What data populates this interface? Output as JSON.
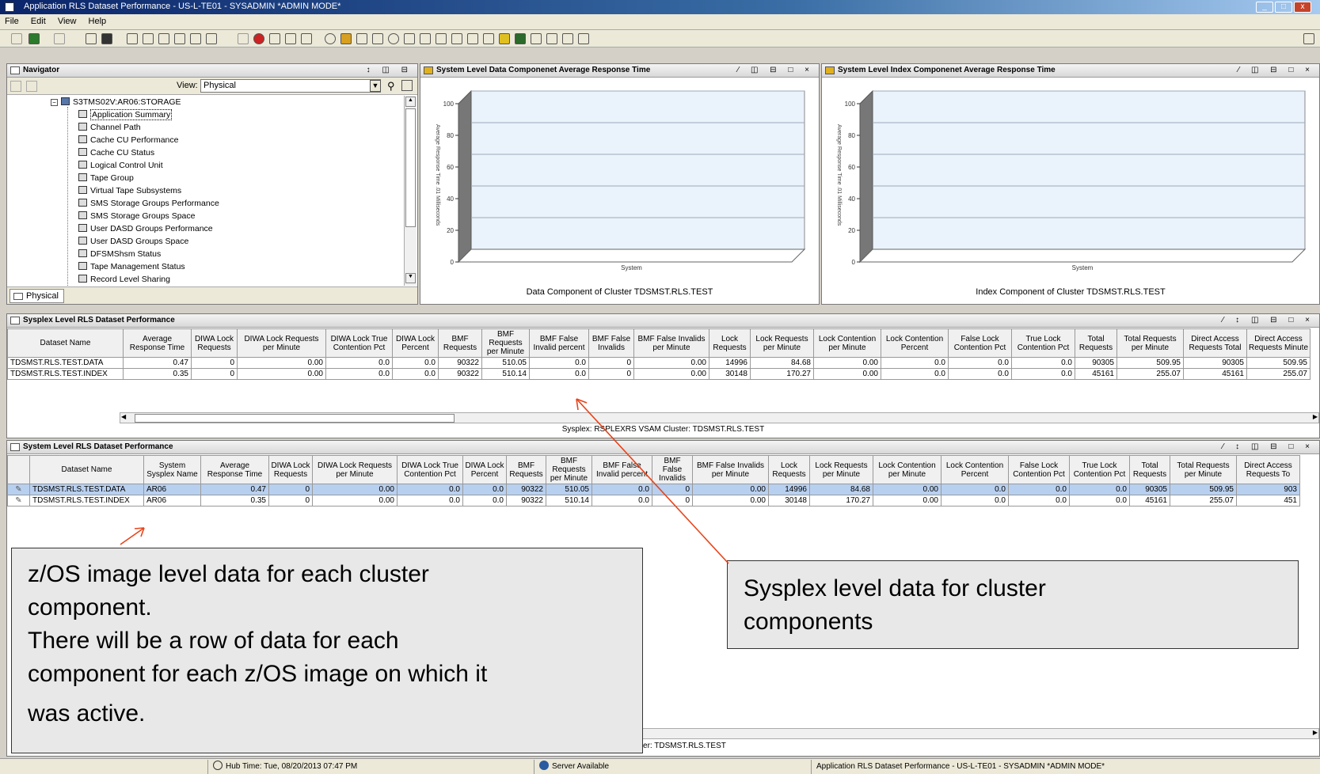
{
  "window": {
    "title": "Application RLS Dataset Performance - US-L-TE01 - SYSADMIN  *ADMIN MODE*"
  },
  "menu": {
    "file": "File",
    "edit": "Edit",
    "view": "View",
    "help": "Help"
  },
  "navigator": {
    "title": "Navigator",
    "view_label": "View:",
    "view_value": "Physical",
    "root": "S3TMS02V:AR06:STORAGE",
    "items": [
      "Application Summary",
      "Channel Path",
      "Cache CU Performance",
      "Cache CU Status",
      "Logical Control Unit",
      "Tape Group",
      "Virtual Tape Subsystems",
      "SMS Storage Groups Performance",
      "SMS Storage Groups Space",
      "User DASD Groups Performance",
      "User DASD Groups Space",
      "DFSMShsm Status",
      "Tape Management Status",
      "Record Level Sharing"
    ],
    "tab": "Physical"
  },
  "chart1": {
    "title": "System Level Data Componenet Average Response Time",
    "caption": "Data Component of Cluster TDSMST.RLS.TEST"
  },
  "chart2": {
    "title": "System Level Index Componenet Average Response Time",
    "caption": "Index Component of Cluster TDSMST.RLS.TEST"
  },
  "chart_data": [
    {
      "type": "bar",
      "title": "System Level Data Componenet Average Response Time",
      "xlabel": "System",
      "ylabel": "Average Response Time .01 Milliseconds",
      "categories": [],
      "values": [],
      "yticks": [
        "0",
        "20",
        "40",
        "60",
        "80",
        "100"
      ],
      "ylim": [
        0,
        100
      ],
      "grid": true
    },
    {
      "type": "bar",
      "title": "System Level Index Componenet Average Response Time",
      "xlabel": "System",
      "ylabel": "Average Response Time .01 Milliseconds",
      "categories": [],
      "values": [],
      "yticks": [
        "0",
        "20",
        "40",
        "60",
        "80",
        "100"
      ],
      "ylim": [
        0,
        100
      ],
      "grid": true
    }
  ],
  "sysplex_table": {
    "title": "Sysplex Level RLS Dataset Performance",
    "columns": [
      "Dataset Name",
      "Average Response Time",
      "DIWA Lock Requests",
      "DIWA Lock Requests per Minute",
      "DIWA Lock True Contention Pct",
      "DIWA Lock Percent",
      "BMF Requests",
      "BMF Requests per Minute",
      "BMF False Invalid percent",
      "BMF False Invalids",
      "BMF False Invalids per Minute",
      "Lock Requests",
      "Lock Requests per Minute",
      "Lock Contention per Minute",
      "Lock Contention Percent",
      "False Lock Contention Pct",
      "True Lock Contention Pct",
      "Total Requests",
      "Total Requests per Minute",
      "Direct Access Requests Total",
      "Direct Access Requests Minute"
    ],
    "rows": [
      [
        "TDSMST.RLS.TEST.DATA",
        "0.47",
        "0",
        "0.00",
        "0.0",
        "0.0",
        "90322",
        "510.05",
        "0.0",
        "0",
        "0.00",
        "14996",
        "84.68",
        "0.00",
        "0.0",
        "0.0",
        "0.0",
        "90305",
        "509.95",
        "90305",
        "509.95"
      ],
      [
        "TDSMST.RLS.TEST.INDEX",
        "0.35",
        "0",
        "0.00",
        "0.0",
        "0.0",
        "90322",
        "510.14",
        "0.0",
        "0",
        "0.00",
        "30148",
        "170.27",
        "0.00",
        "0.0",
        "0.0",
        "0.0",
        "45161",
        "255.07",
        "45161",
        "255.07"
      ]
    ],
    "footer": "Sysplex: RSPLEXRS  VSAM Cluster: TDSMST.RLS.TEST"
  },
  "system_table": {
    "title": "System Level RLS Dataset Performance",
    "columns": [
      "",
      "Dataset Name",
      "System Sysplex Name",
      "Average Response Time",
      "DIWA Lock Requests",
      "DIWA Lock Requests per Minute",
      "DIWA Lock True Contention Pct",
      "DIWA Lock Percent",
      "BMF Requests",
      "BMF Requests per Minute",
      "BMF False Invalid percent",
      "BMF False Invalids",
      "BMF False Invalids per Minute",
      "Lock Requests",
      "Lock Requests per Minute",
      "Lock Contention per Minute",
      "Lock Contention Percent",
      "False Lock Contention Pct",
      "True Lock Contention Pct",
      "Total Requests",
      "Total Requests per Minute",
      "Direct Access Requests To"
    ],
    "rows": [
      [
        "",
        "TDSMST.RLS.TEST.DATA",
        "AR06",
        "0.47",
        "0",
        "0.00",
        "0.0",
        "0.0",
        "90322",
        "510.05",
        "0.0",
        "0",
        "0.00",
        "14996",
        "84.68",
        "0.00",
        "0.0",
        "0.0",
        "0.0",
        "90305",
        "509.95",
        "903"
      ],
      [
        "",
        "TDSMST.RLS.TEST.INDEX",
        "AR06",
        "0.35",
        "0",
        "0.00",
        "0.0",
        "0.0",
        "90322",
        "510.14",
        "0.0",
        "0",
        "0.00",
        "30148",
        "170.27",
        "0.00",
        "0.0",
        "0.0",
        "0.0",
        "45161",
        "255.07",
        "451"
      ]
    ],
    "footer": "VSAM Cluster:  TDSMST.RLS.TEST"
  },
  "annotations": {
    "left_lines": [
      "z/OS image level data for each cluster",
      "component.",
      "There will be a row of data for each",
      "component for each z/OS image on which it",
      "was active."
    ],
    "right_lines": [
      "Sysplex level data for cluster",
      "components"
    ],
    "arrow_color": "#e8441a"
  },
  "statusbar": {
    "hub_time": "Hub Time: Tue, 08/20/2013 07:47 PM",
    "server": "Server Available",
    "workspace": "Application RLS Dataset Performance - US-L-TE01 - SYSADMIN  *ADMIN MODE*"
  }
}
